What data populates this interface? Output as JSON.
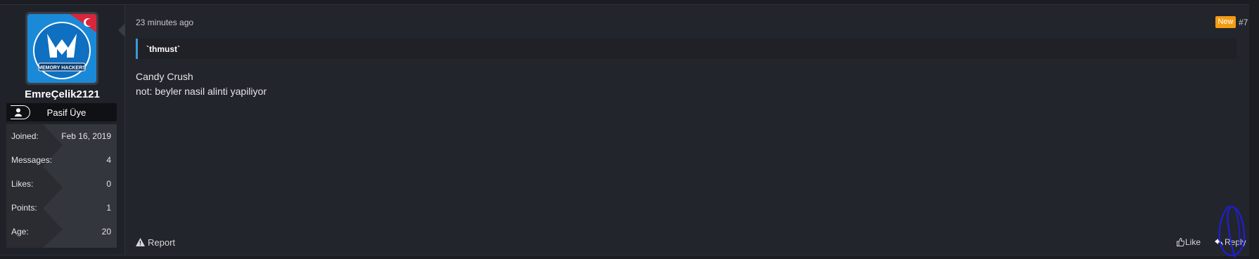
{
  "user": {
    "avatar_text": "MEMORY HACKERS",
    "username": "EmreÇelik2121",
    "rank": "Pasif Üye",
    "stats": [
      {
        "label": "Joined:",
        "value": "Feb 16, 2019"
      },
      {
        "label": "Messages:",
        "value": "4"
      },
      {
        "label": "Likes:",
        "value": "0"
      },
      {
        "label": "Points:",
        "value": "1"
      },
      {
        "label": "Age:",
        "value": "20"
      }
    ]
  },
  "post": {
    "time": "23 minutes ago",
    "new_badge": "New",
    "number": "#7",
    "quote": "`thmust`",
    "lines": [
      "Candy Crush",
      "not: beyler nasil alinti yapiliyor"
    ]
  },
  "actions": {
    "report": "Report",
    "like": "Like",
    "reply": "Reply"
  },
  "colors": {
    "accent": "#3d9ad6",
    "badge": "#f39c12",
    "annotation": "#1e1ee6"
  }
}
